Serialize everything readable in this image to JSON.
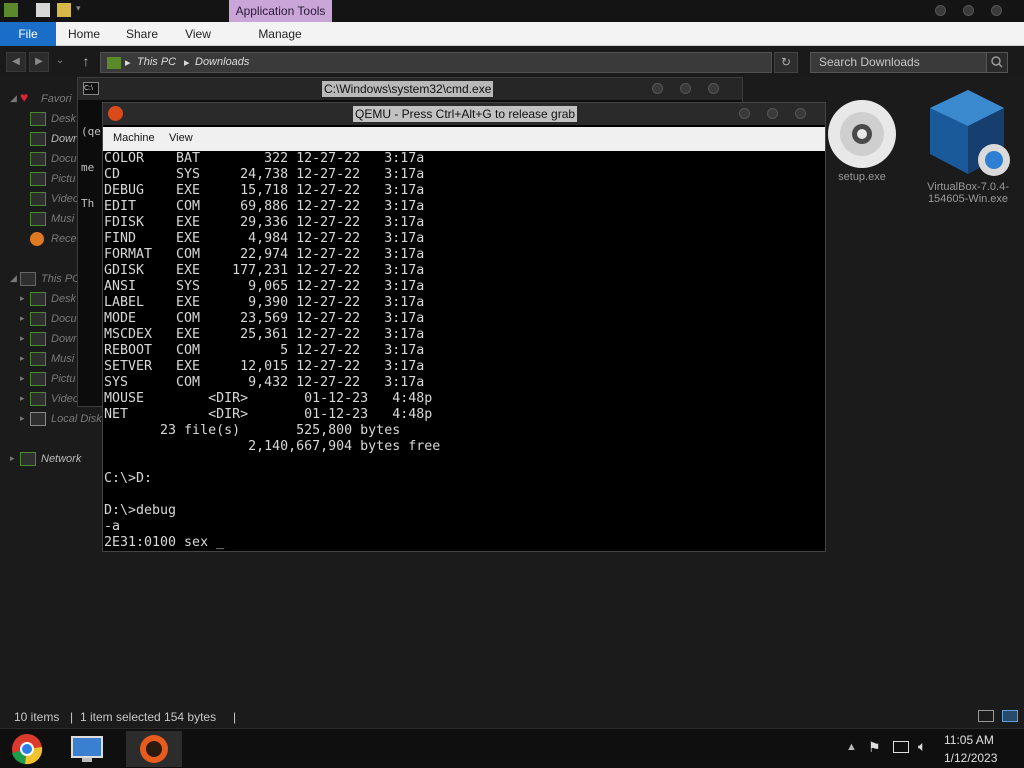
{
  "ribbon": {
    "context_tab": "Application Tools",
    "file": "File",
    "tabs": [
      "Home",
      "Share",
      "View",
      "Manage"
    ]
  },
  "address": {
    "crumbs": [
      "This PC",
      "Downloads"
    ],
    "search_placeholder": "Search Downloads"
  },
  "navpane": {
    "favorites": [
      {
        "label": "Favori",
        "icon": "heart-icon"
      },
      {
        "label": "Desk",
        "icon": "desktop-folder-icon"
      },
      {
        "label": "Down",
        "icon": "downloads-folder-icon"
      },
      {
        "label": "Docu",
        "icon": "documents-folder-icon"
      },
      {
        "label": "Pictu",
        "icon": "pictures-folder-icon"
      },
      {
        "label": "Video",
        "icon": "videos-folder-icon"
      },
      {
        "label": "Musi",
        "icon": "music-folder-icon"
      },
      {
        "label": "Rece",
        "icon": "recent-icon"
      }
    ],
    "thispc": [
      {
        "label": "This PC",
        "icon": "computer-icon"
      },
      {
        "label": "Desk",
        "icon": "desktop-folder-icon"
      },
      {
        "label": "Docu",
        "icon": "documents-folder-icon"
      },
      {
        "label": "Down",
        "icon": "downloads-folder-icon"
      },
      {
        "label": "Musi",
        "icon": "music-folder-icon"
      },
      {
        "label": "Pictu",
        "icon": "pictures-folder-icon"
      },
      {
        "label": "Video",
        "icon": "videos-folder-icon"
      },
      {
        "label": "Local Disk",
        "icon": "disk-icon"
      }
    ],
    "network": "Network"
  },
  "files": {
    "setup": "setup.exe",
    "vbox_line1": "VirtualBox-7.0.4-",
    "vbox_line2": "154605-Win.exe"
  },
  "cmd": {
    "title": "C:\\Windows\\system32\\cmd.exe",
    "lines": [
      "(qe",
      "me",
      "Th"
    ]
  },
  "qemu": {
    "title": "QEMU - Press Ctrl+Alt+G to release grab",
    "menu": [
      "Machine",
      "View"
    ],
    "screen": "COLOR    BAT        322 12-27-22   3:17a\nCD       SYS     24,738 12-27-22   3:17a\nDEBUG    EXE     15,718 12-27-22   3:17a\nEDIT     COM     69,886 12-27-22   3:17a\nFDISK    EXE     29,336 12-27-22   3:17a\nFIND     EXE      4,984 12-27-22   3:17a\nFORMAT   COM     22,974 12-27-22   3:17a\nGDISK    EXE    177,231 12-27-22   3:17a\nANSI     SYS      9,065 12-27-22   3:17a\nLABEL    EXE      9,390 12-27-22   3:17a\nMODE     COM     23,569 12-27-22   3:17a\nMSCDEX   EXE     25,361 12-27-22   3:17a\nREBOOT   COM          5 12-27-22   3:17a\nSETVER   EXE     12,015 12-27-22   3:17a\nSYS      COM      9,432 12-27-22   3:17a\nMOUSE        <DIR>       01-12-23   4:48p\nNET          <DIR>       01-12-23   4:48p\n       23 file(s)       525,800 bytes\n                  2,140,667,904 bytes free\n\nC:\\>D:\n\nD:\\>debug\n-a\n2E31:0100 sex _"
  },
  "status": {
    "items": "10 items",
    "selected": "1 item selected  154 bytes"
  },
  "taskbar": {
    "time": "11:05 AM",
    "date": "1/12/2023",
    "apps": [
      "chrome-icon",
      "computer-icon",
      "qemu-icon"
    ]
  }
}
